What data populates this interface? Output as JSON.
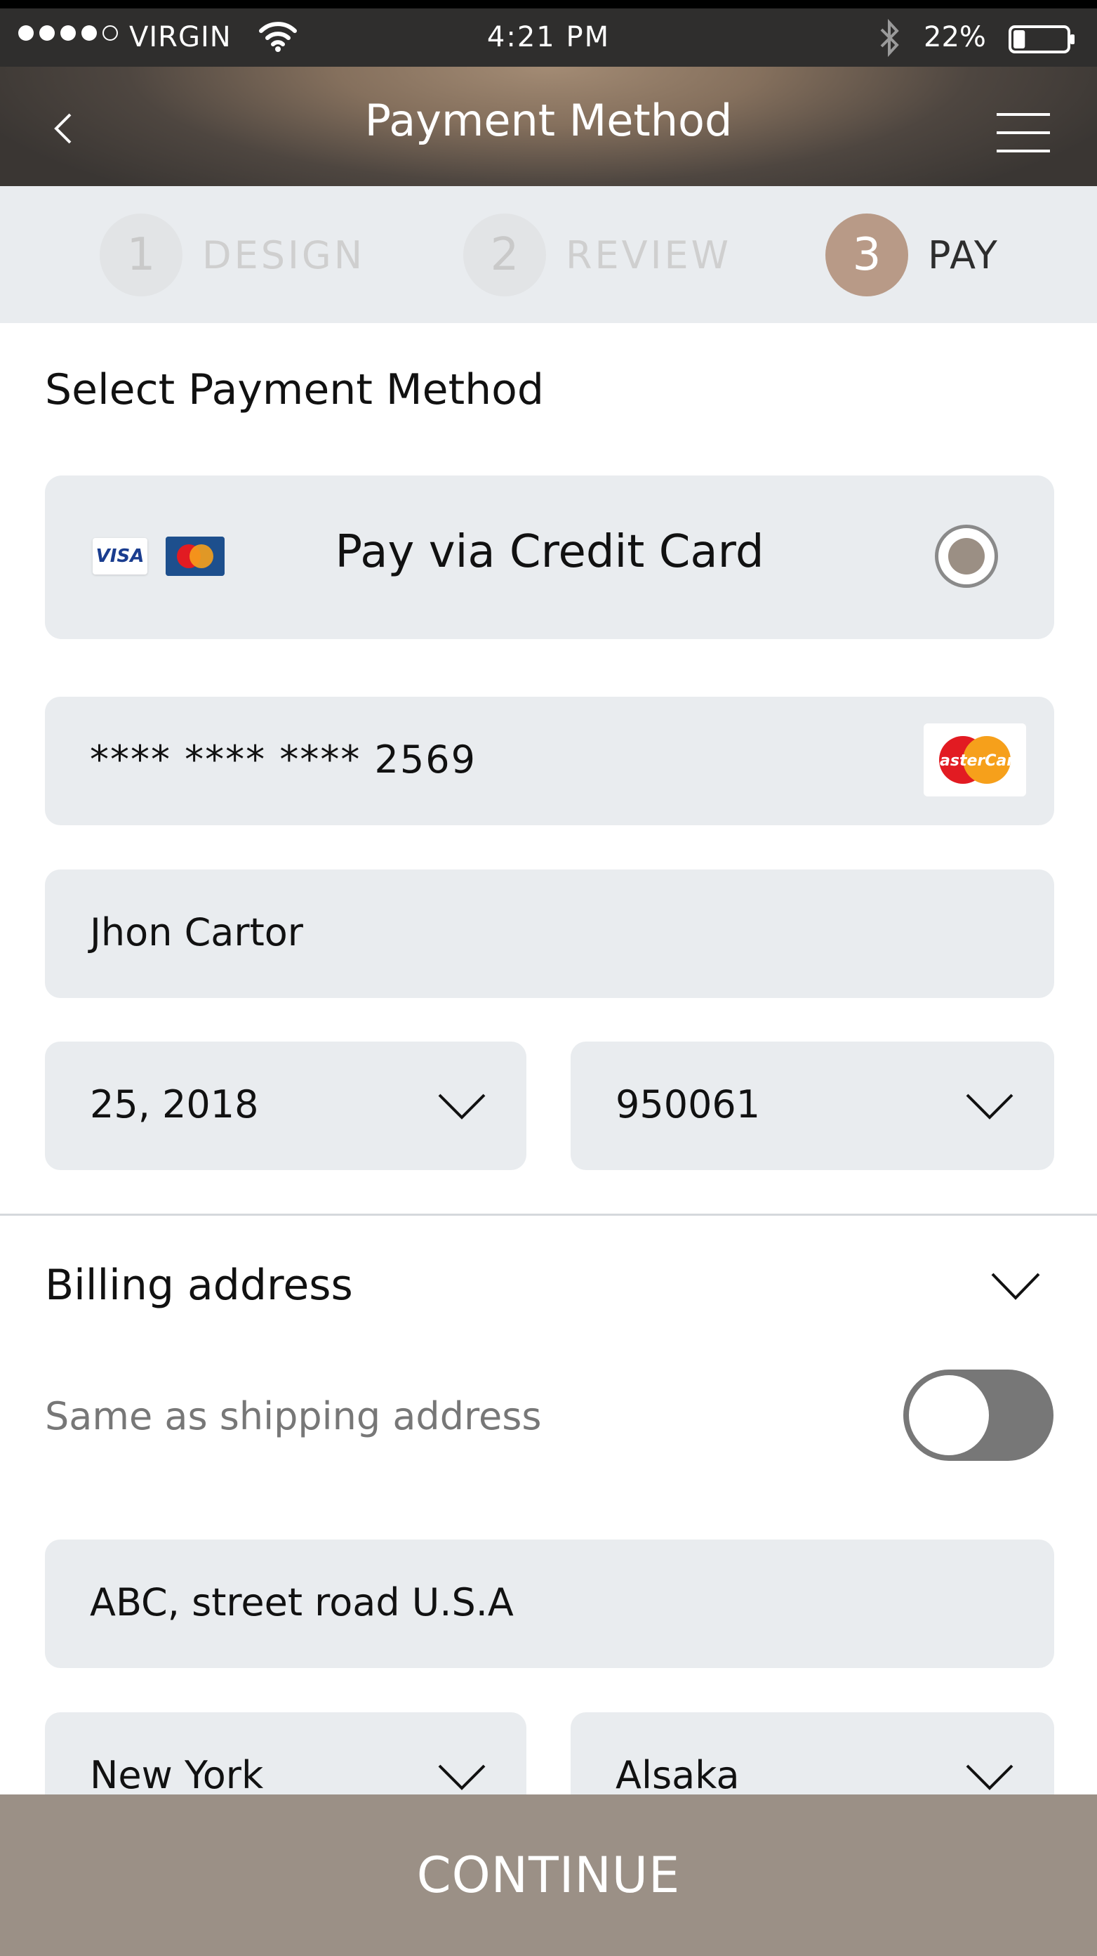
{
  "status_bar": {
    "carrier": "VIRGIN",
    "time": "4:21 PM",
    "battery": "22%",
    "signal_bars_filled": 4,
    "signal_bars_total": 5,
    "battery_level": 0.22
  },
  "header": {
    "title": "Payment Method",
    "back_icon": "chevron-left-icon",
    "menu_icon": "hamburger-menu-icon"
  },
  "steps": [
    {
      "number": "1",
      "label": "DESIGN",
      "state": "inactive"
    },
    {
      "number": "2",
      "label": "REVIEW",
      "state": "inactive"
    },
    {
      "number": "3",
      "label": "PAY",
      "state": "active"
    }
  ],
  "payment": {
    "section_title": "Select Payment Method",
    "option_label": "Pay via Credit Card",
    "visa_text": "VISA",
    "option_selected": true,
    "card_number": "**** **** **** 2569",
    "card_holder": "Jhon Cartor",
    "expiry": "25, 2018",
    "code": "950061"
  },
  "billing": {
    "title": "Billing address",
    "same_as_shipping_label": "Same as shipping address",
    "same_as_shipping": false,
    "street": "ABC, street road U.S.A",
    "city": "New York",
    "state": "Alsaka"
  },
  "footer": {
    "continue_label": "CONTINUE"
  },
  "colors": {
    "accent": "#b89a87",
    "field_bg": "#e9ecef",
    "continue_bg": "#9b9086",
    "status_bar_bg": "#2f2e2d"
  }
}
